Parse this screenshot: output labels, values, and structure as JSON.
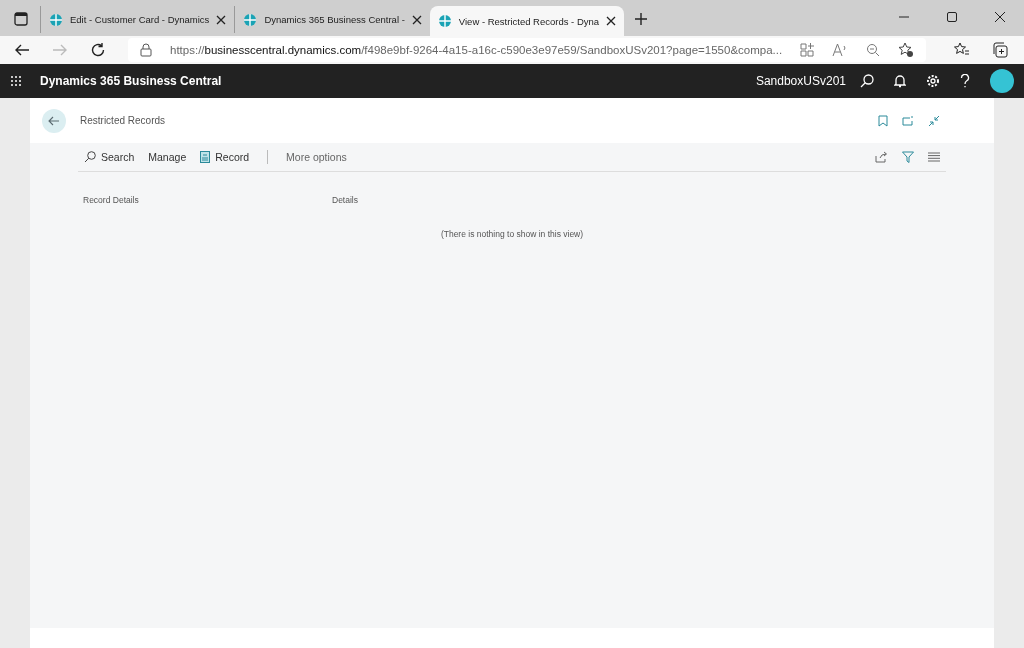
{
  "tabs": [
    {
      "label": "Edit - Customer Card - Dynamics",
      "selected": false
    },
    {
      "label": "Dynamics 365 Business Central -",
      "selected": false
    },
    {
      "label": "View - Restricted Records - Dyna",
      "selected": true
    }
  ],
  "address": {
    "prefix": "https://",
    "host": "businesscentral.dynamics.com",
    "path": "/f498e9bf-9264-4a15-a16c-c590e3e97e59/SandboxUSv201?page=1550&compa..."
  },
  "app_bar": {
    "title": "Dynamics 365 Business Central",
    "environment": "SandboxUSv201"
  },
  "page": {
    "title": "Restricted Records",
    "actions": [
      {
        "kind": "search",
        "label": "Search"
      },
      {
        "kind": "plain",
        "label": "Manage"
      },
      {
        "kind": "record",
        "label": "Record"
      },
      {
        "kind": "divider",
        "label": "More options"
      }
    ],
    "columns": [
      "Record Details",
      "Details"
    ],
    "empty_message": "(There is nothing to show in this view)"
  }
}
